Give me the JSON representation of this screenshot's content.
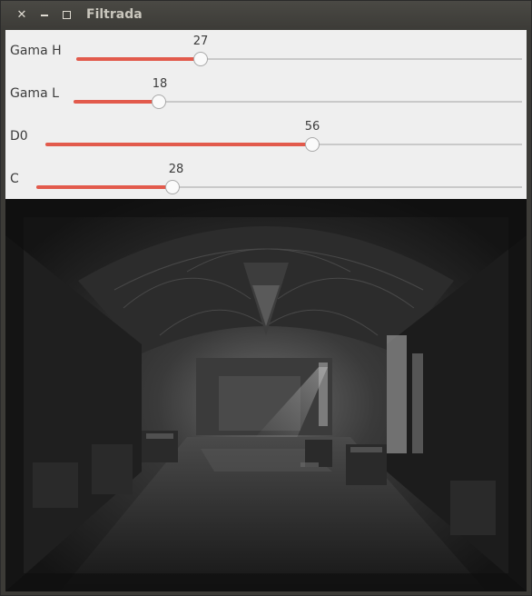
{
  "window": {
    "title": "Filtrada"
  },
  "titlebar": {
    "close_icon": "close-icon",
    "minimize_icon": "minimize-icon",
    "maximize_icon": "maximize-icon"
  },
  "trackbars": [
    {
      "label": "Gama H",
      "value": "27",
      "fraction": 0.28
    },
    {
      "label": "Gama L",
      "value": "18",
      "fraction": 0.19
    },
    {
      "label": "D0",
      "value": "56",
      "fraction": 0.56
    },
    {
      "label": "C",
      "value": "28",
      "fraction": 0.28
    }
  ],
  "colors": {
    "slider_fill": "#e25a4c",
    "panel_bg": "#efefef",
    "titlebar_bg": "#3c3b37"
  }
}
